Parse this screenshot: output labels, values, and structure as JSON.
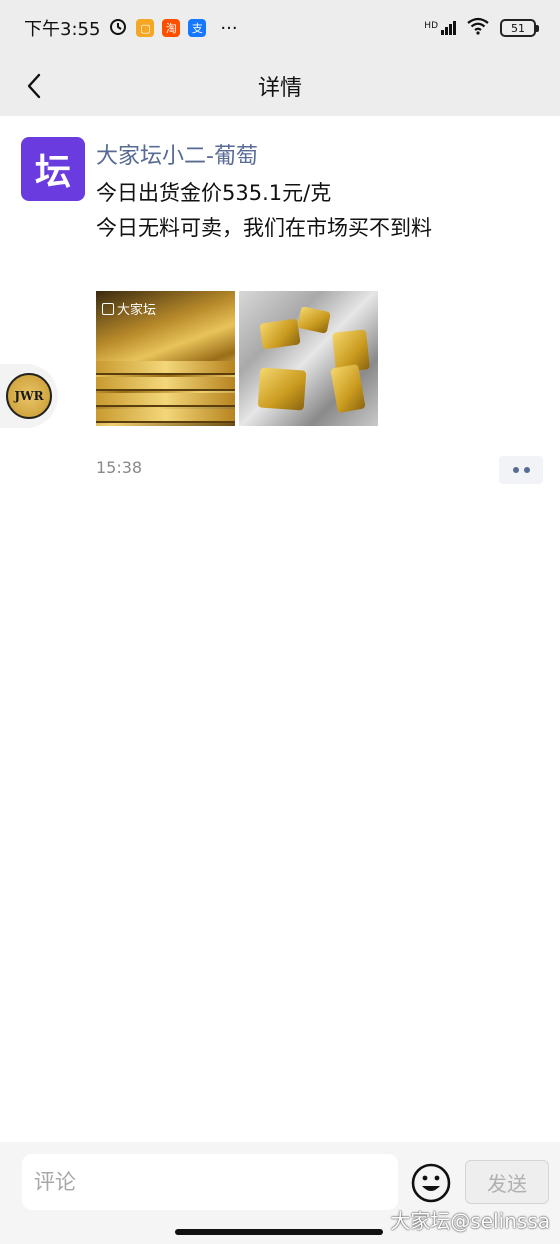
{
  "status_bar": {
    "time": "下午3:55",
    "more": "···",
    "network": "HD",
    "battery": "51"
  },
  "nav": {
    "title": "详情"
  },
  "post": {
    "avatar_char": "坛",
    "author": "大家坛小二-葡萄",
    "text_lines": [
      "今日出货金价535.1元/克",
      "今日无料可卖，我们在市场买不到料"
    ],
    "photo_watermark": "大家坛",
    "time": "15:38"
  },
  "floating_badge": {
    "label": "JWR"
  },
  "comment_bar": {
    "placeholder": "评论",
    "send_label": "发送"
  },
  "watermark": "大家坛@selinssa",
  "colors": {
    "author_blue": "#576b95",
    "avatar_purple": "#6a3bdf",
    "nav_background": "#ededed"
  }
}
